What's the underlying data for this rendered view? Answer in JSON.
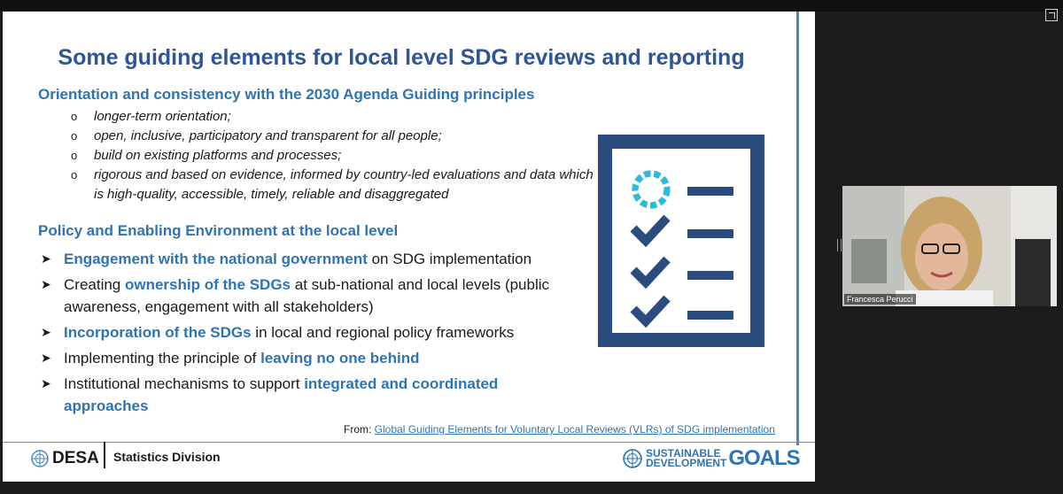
{
  "slide": {
    "title": "Some guiding elements for local level SDG reviews and reporting",
    "section1_heading": "Orientation and consistency with the 2030 Agenda Guiding principles",
    "sub_bullets": [
      "longer-term orientation;",
      "open, inclusive, participatory and transparent for all people;",
      "build on existing platforms and processes;",
      "rigorous and based on evidence, informed by country-led evaluations and data which is high-quality, accessible, timely, reliable and disaggregated"
    ],
    "section2_heading": "Policy and Enabling Environment at the local level",
    "main_bullets": [
      {
        "pre": "",
        "hl": "Engagement with the national government",
        "post": " on SDG implementation"
      },
      {
        "pre": "Creating ",
        "hl": "ownership of the SDGs",
        "post": " at sub-national and local levels (public awareness, engagement with all stakeholders)"
      },
      {
        "pre": "",
        "hl": "Incorporation of the SDGs",
        "post": " in local and regional policy frameworks"
      },
      {
        "pre": "Implementing the principle of ",
        "hl": "leaving no one behind",
        "post": ""
      },
      {
        "pre": "Institutional mechanisms to support ",
        "hl": "integrated and coordinated approaches",
        "post": ""
      }
    ],
    "source_prefix": "From: ",
    "source_link": "Global Guiding Elements for Voluntary Local Reviews (VLRs) of SDG implementation",
    "footer": {
      "desa": "DESA",
      "division": "Statistics Division",
      "sdg_line1": "SUSTAINABLE",
      "sdg_line2": "DEVELOPMENT",
      "goals": "GOALS"
    }
  },
  "video": {
    "participant_name": "Francesca Perucci"
  },
  "colors": {
    "title": "#2f5597",
    "accent": "#2e74b5",
    "checklist": "#2b4c7e"
  },
  "icons": [
    "un-emblem-icon",
    "sdg-wheel-icon",
    "checkmark-icon",
    "bullet-arrow-icon",
    "maximize-icon"
  ]
}
